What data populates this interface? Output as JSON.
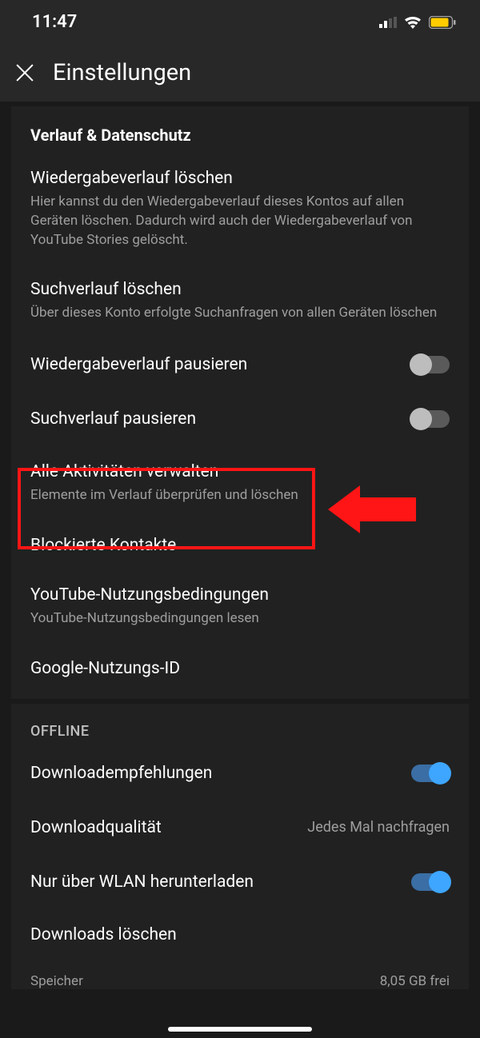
{
  "status": {
    "time": "11:47"
  },
  "header": {
    "title": "Einstellungen"
  },
  "section1": {
    "title": "Verlauf & Datenschutz",
    "items": [
      {
        "title": "Wiedergabeverlauf löschen",
        "sub": "Hier kannst du den Wiedergabeverlauf dieses Kontos auf allen Geräten löschen. Dadurch wird auch der Wiedergabeverlauf von YouTube Stories gelöscht."
      },
      {
        "title": "Suchverlauf löschen",
        "sub": "Über dieses Konto erfolgte Suchanfragen von allen Geräten löschen"
      },
      {
        "title": "Wiedergabeverlauf pausieren"
      },
      {
        "title": "Suchverlauf pausieren"
      },
      {
        "title": "Alle Aktivitäten verwalten",
        "sub": "Elemente im Verlauf überprüfen und löschen"
      },
      {
        "title": "Blockierte Kontakte"
      },
      {
        "title": "YouTube-Nutzungsbedingungen",
        "sub": "YouTube-Nutzungsbedingungen lesen"
      },
      {
        "title": "Google-Nutzungs-ID"
      }
    ]
  },
  "section2": {
    "title": "OFFLINE",
    "items": [
      {
        "title": "Downloadempfehlungen"
      },
      {
        "title": "Downloadqualität",
        "value": "Jedes Mal nachfragen"
      },
      {
        "title": "Nur über WLAN herunterladen"
      },
      {
        "title": "Downloads löschen"
      }
    ],
    "storage": {
      "label": "Speicher",
      "value": "8,05 GB frei"
    }
  }
}
